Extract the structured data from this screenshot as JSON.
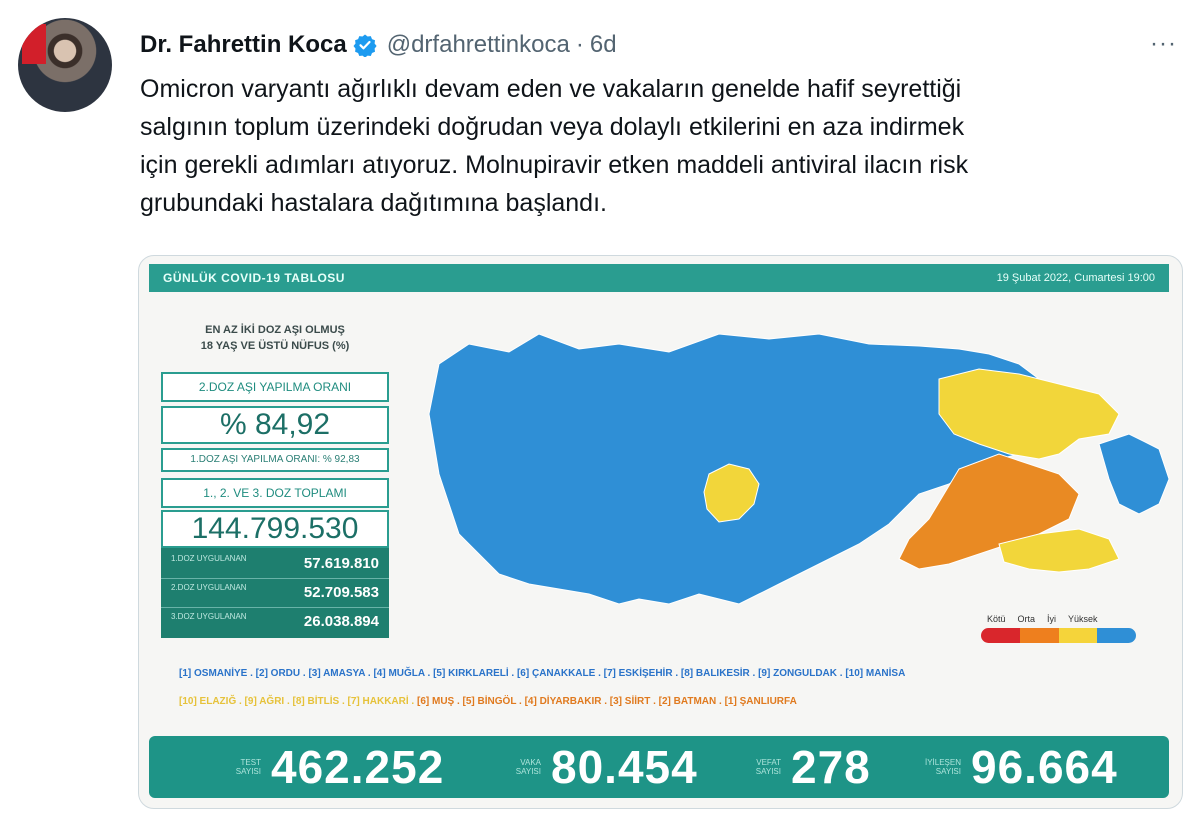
{
  "tweet": {
    "name": "Dr. Fahrettin Koca",
    "handle": "@drfahrettinkoca",
    "separator": "·",
    "time": "6d",
    "more": "···",
    "text_lines": [
      "Omicron varyantı ağırlıklı devam eden ve vakaların genelde hafif seyrettiği",
      "salgının toplum üzerindeki doğrudan veya dolaylı etkilerini en aza indirmek",
      "için gerekli adımları atıyoruz. Molnupiravir etken maddeli antiviral ilacın risk",
      "grubundaki hastalara dağıtımına başlandı."
    ]
  },
  "media": {
    "title": "GÜNLÜK COVID-19 TABLOSU",
    "date": "19 Şubat 2022, Cumartesi 19:00",
    "heading_line1": "EN AZ İKİ DOZ AŞI OLMUŞ",
    "heading_line2": "18 YAŞ VE ÜSTÜ NÜFUS (%)",
    "dose2_label": "2.DOZ AŞI YAPILMA ORANI",
    "dose2_value": "% 84,92",
    "dose1_label": "1.DOZ AŞI YAPILMA ORANI: % 92,83",
    "total_label": "1., 2. VE 3. DOZ TOPLAMI",
    "total_value": "144.799.530",
    "doses": [
      {
        "label": "1.DOZ UYGULANAN",
        "value": "57.619.810"
      },
      {
        "label": "2.DOZ UYGULANAN",
        "value": "52.709.583"
      },
      {
        "label": "3.DOZ UYGULANAN",
        "value": "26.038.894"
      }
    ],
    "legend": {
      "labels": [
        "Kötü",
        "Orta",
        "İyi",
        "Yüksek"
      ],
      "colors": [
        "#d9262c",
        "#ee7f1e",
        "#f5d43a",
        "#2f8fd6"
      ]
    },
    "cities_blue": "[1] OSMANİYE . [2] ORDU . [3] AMASYA . [4] MUĞLA . [5] KIRKLARELİ . [6] ÇANAKKALE . [7] ESKİŞEHİR . [8] BALIKESİR . [9] ZONGULDAK . [10] MANİSA",
    "cities_yellow": "[10] ELAZIĞ . [9] AĞRI . [8] BİTLİS . [7] HAKKARİ .",
    "cities_orange": "[6] MUŞ . [5] BİNGÖL . [4] DİYARBAKIR . [3] SİİRT . [2] BATMAN . [1] ŞANLIURFA",
    "stats": [
      {
        "label": "TEST SAYISI",
        "value": "462.252"
      },
      {
        "label": "VAKA SAYISI",
        "value": "80.454"
      },
      {
        "label": "VEFAT SAYISI",
        "value": "278"
      },
      {
        "label": "İYİLEŞEN SAYISI",
        "value": "96.664"
      }
    ],
    "colors": {
      "teal": "#1e9487",
      "map_blue": "#2f8fd6",
      "map_yellow": "#f2d63a",
      "map_orange": "#e98a23"
    }
  }
}
